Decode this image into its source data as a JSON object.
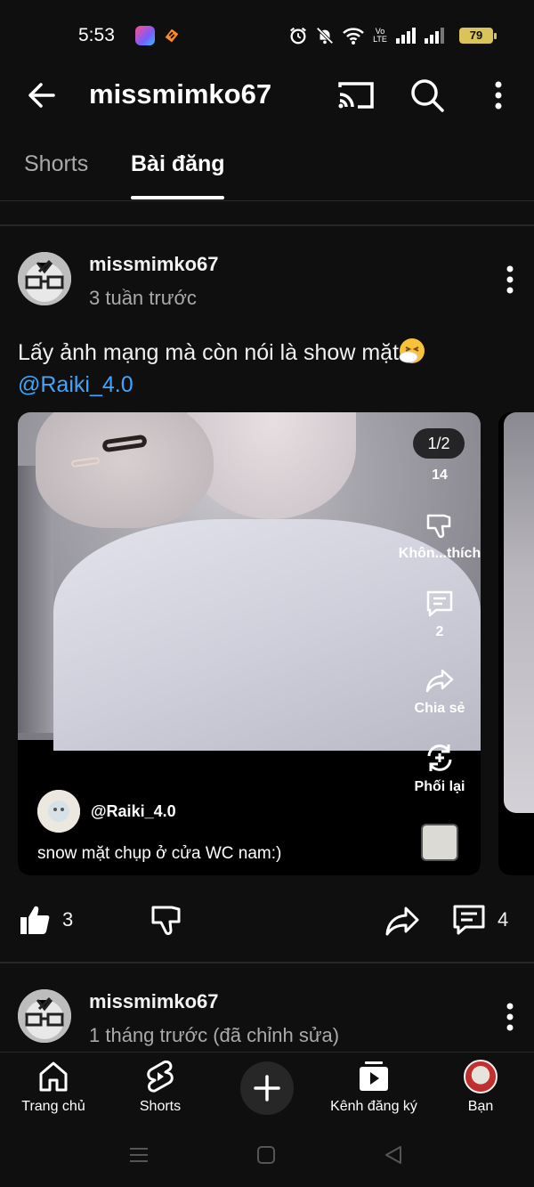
{
  "status_bar": {
    "time": "5:53",
    "battery": "79",
    "lte_label": "Vo LTE"
  },
  "header": {
    "channel_name": "missmimko67"
  },
  "tabs": [
    {
      "label": "Shorts",
      "selected": false
    },
    {
      "label": "Bài đăng",
      "selected": true
    }
  ],
  "post1": {
    "author": "missmimko67",
    "time": "3 tuần trước",
    "text": "Lấy ảnh mạng mà còn nói là show mặt",
    "mention": "@Raiki_4.0",
    "image_counter": "1/2",
    "side_actions": {
      "likes": "14",
      "dislike_label": "Khôn...thích",
      "comments": "2",
      "share_label": "Chia sẻ",
      "remix_label": "Phối lại"
    },
    "creator_handle": "@Raiki_4.0",
    "caption": "snow mặt chụp ở cửa WC nam:)",
    "like_count": "3",
    "comment_count": "4"
  },
  "post2": {
    "author": "missmimko67",
    "time": "1 tháng trước (đã chỉnh sửa)"
  },
  "bottom_nav": [
    {
      "label": "Trang chủ",
      "icon": "home-icon"
    },
    {
      "label": "Shorts",
      "icon": "shorts-icon"
    },
    {
      "label": "",
      "icon": "plus-icon"
    },
    {
      "label": "Kênh đăng ký",
      "icon": "subscriptions-icon"
    },
    {
      "label": "Bạn",
      "icon": "avatar"
    }
  ],
  "colors": {
    "background": "#0f0f0f",
    "text": "#f1f1f1",
    "secondary_text": "#aaaaaa",
    "mention": "#3ea6ff",
    "battery": "#d9c35a"
  }
}
